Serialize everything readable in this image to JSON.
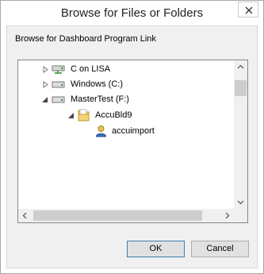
{
  "window": {
    "title": "Browse for Files or Folders"
  },
  "prompt": "Browse for Dashboard Program Link",
  "tree": {
    "nodes": [
      {
        "label": "C on LISA",
        "icon": "network-drive-icon",
        "state": "collapsed"
      },
      {
        "label": "Windows (C:)",
        "icon": "drive-icon",
        "state": "collapsed"
      },
      {
        "label": "MasterTest (F:)",
        "icon": "drive-icon",
        "state": "expanded"
      },
      {
        "label": "AccuBld9",
        "icon": "folder-icon",
        "state": "expanded"
      },
      {
        "label": "accuimport",
        "icon": "user-icon",
        "state": "none"
      }
    ]
  },
  "buttons": {
    "ok": "OK",
    "cancel": "Cancel"
  },
  "colors": {
    "scroll_thumb": "#cdcdcd",
    "folder": "#e8c25a",
    "user": "#3a70c0"
  }
}
